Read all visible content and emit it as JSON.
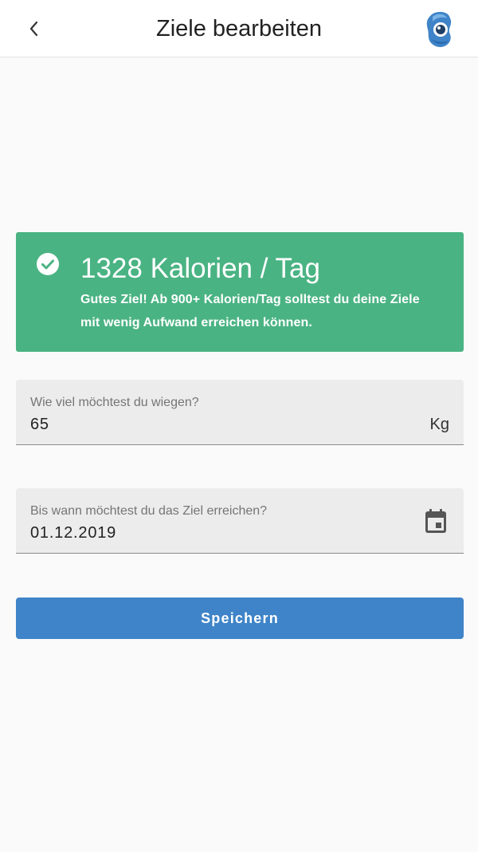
{
  "header": {
    "title": "Ziele bearbeiten",
    "back_icon": "chevron-left-icon",
    "logo_icon": "app-logo-icon"
  },
  "goal_card": {
    "headline": "1328 Kalorien / Tag",
    "message": "Gutes Ziel! Ab 900+ Kalorien/Tag solltest du deine Ziele mit wenig Aufwand erreichen können.",
    "icon": "check-circle-icon",
    "background_color": "#4ab383"
  },
  "weight_field": {
    "label": "Wie viel möchtest du wiegen?",
    "value": "65",
    "suffix": "Kg"
  },
  "date_field": {
    "label": "Bis wann möchtest du das Ziel erreichen?",
    "value": "01.12.2019",
    "icon": "calendar-icon"
  },
  "save_button": {
    "label": "Speichern",
    "color": "#3f84c8"
  }
}
